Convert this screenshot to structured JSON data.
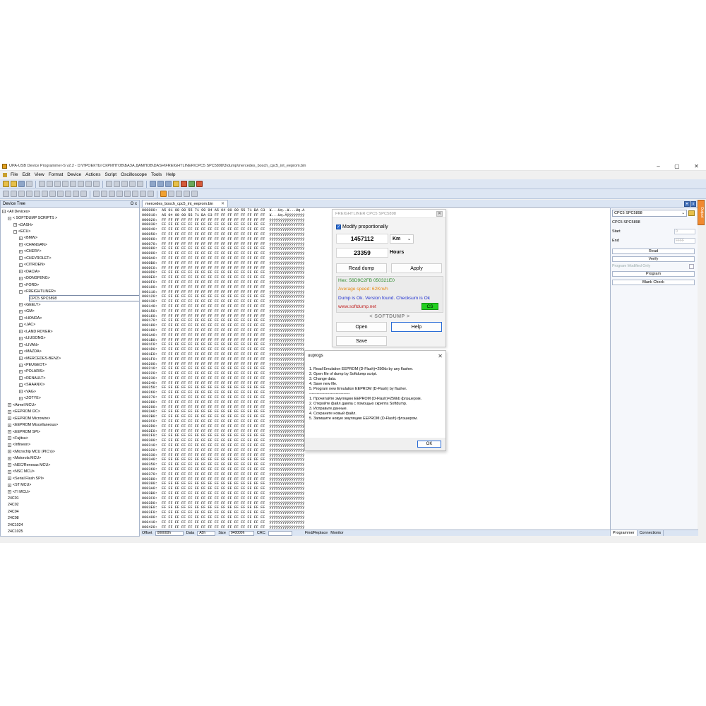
{
  "window": {
    "title": "UPA-USB Device Programmer-S v2.2 - D:\\ПРОЕКТЫ СКРИПТОВ\\БАЗА ДАМПОВ\\DASH\\FREIGHTLINER\\CPC5 SPC5898\\3\\dump\\mercedes_bosch_cpc5_int_eeprom.bin",
    "minimize": "–",
    "maximize": "▢",
    "close": "✕"
  },
  "menu": [
    "File",
    "Edit",
    "View",
    "Format",
    "Device",
    "Actions",
    "Script",
    "Oscilloscope",
    "Tools",
    "Help"
  ],
  "tree": {
    "header": "Device Tree",
    "pin": "ʘ x",
    "items": [
      {
        "label": "<All Devices>",
        "level": 0,
        "exp": "⊟"
      },
      {
        "label": "< SOFTDUMP SCRIPTS >",
        "level": 1,
        "exp": "⊟"
      },
      {
        "label": "<DASH>",
        "level": 2,
        "exp": "⊞"
      },
      {
        "label": "<ECU>",
        "level": 2,
        "exp": "⊟"
      },
      {
        "label": "<BMW>",
        "level": 3,
        "exp": "⊞"
      },
      {
        "label": "<CHANGAN>",
        "level": 3,
        "exp": "⊞"
      },
      {
        "label": "<CHERY>",
        "level": 3,
        "exp": "⊞"
      },
      {
        "label": "<CHEVROLET>",
        "level": 3,
        "exp": "⊞"
      },
      {
        "label": "<CITROEN>",
        "level": 3,
        "exp": "⊞"
      },
      {
        "label": "<DACIA>",
        "level": 3,
        "exp": "⊞"
      },
      {
        "label": "<DONGFENG>",
        "level": 3,
        "exp": "⊞"
      },
      {
        "label": "<FORD>",
        "level": 3,
        "exp": "⊞"
      },
      {
        "label": "<FREIGHTLINER>",
        "level": 3,
        "exp": "⊟"
      },
      {
        "label": "CPC5 SPC5898",
        "level": 5,
        "exp": "",
        "selected": true
      },
      {
        "label": "<GEELY>",
        "level": 3,
        "exp": "⊞"
      },
      {
        "label": "<GM>",
        "level": 3,
        "exp": "⊞"
      },
      {
        "label": "<HONDA>",
        "level": 3,
        "exp": "⊞"
      },
      {
        "label": "<JAC>",
        "level": 3,
        "exp": "⊞"
      },
      {
        "label": "<LAND ROVER>",
        "level": 3,
        "exp": "⊞"
      },
      {
        "label": "<LIUGONG>",
        "level": 3,
        "exp": "⊞"
      },
      {
        "label": "<LIVAN>",
        "level": 3,
        "exp": "⊞"
      },
      {
        "label": "<MAZDA>",
        "level": 3,
        "exp": "⊞"
      },
      {
        "label": "<MERCEDES-BENZ>",
        "level": 3,
        "exp": "⊞"
      },
      {
        "label": "<PEUGEOT>",
        "level": 3,
        "exp": "⊞"
      },
      {
        "label": "<POLARIS>",
        "level": 3,
        "exp": "⊞"
      },
      {
        "label": "<RENAULT>",
        "level": 3,
        "exp": "⊞"
      },
      {
        "label": "<SHAANXI>",
        "level": 3,
        "exp": "⊞"
      },
      {
        "label": "<VAG>",
        "level": 3,
        "exp": "⊞"
      },
      {
        "label": "<ZOTYE>",
        "level": 3,
        "exp": "⊞"
      },
      {
        "label": "<Atmel MCU>",
        "level": 1,
        "exp": "⊞"
      },
      {
        "label": "<EEPROM I2C>",
        "level": 1,
        "exp": "⊞"
      },
      {
        "label": "<EEPROM Microwire>",
        "level": 1,
        "exp": "⊞"
      },
      {
        "label": "<EEPROM Miscellaneous>",
        "level": 1,
        "exp": "⊞"
      },
      {
        "label": "<EEPROM SPI>",
        "level": 1,
        "exp": "⊞"
      },
      {
        "label": "<Fujitsu>",
        "level": 1,
        "exp": "⊞"
      },
      {
        "label": "<Infineon>",
        "level": 1,
        "exp": "⊞"
      },
      {
        "label": "<Microchip MCU (PIC's)>",
        "level": 1,
        "exp": "⊞"
      },
      {
        "label": "<Motorola MCU>",
        "level": 1,
        "exp": "⊞"
      },
      {
        "label": "<NEC/Renesas MCU>",
        "level": 1,
        "exp": "⊞"
      },
      {
        "label": "<NSC MCU>",
        "level": 1,
        "exp": "⊞"
      },
      {
        "label": "<Serial Flash SPI>",
        "level": 1,
        "exp": "⊞"
      },
      {
        "label": "<ST MCU>",
        "level": 1,
        "exp": "⊞"
      },
      {
        "label": "<TI MCU>",
        "level": 1,
        "exp": "⊞"
      },
      {
        "label": "24C01",
        "level": 1,
        "exp": ""
      },
      {
        "label": "24C02",
        "level": 1,
        "exp": ""
      },
      {
        "label": "24C04",
        "level": 1,
        "exp": ""
      },
      {
        "label": "24C08",
        "level": 1,
        "exp": ""
      },
      {
        "label": "24C1024",
        "level": 1,
        "exp": ""
      },
      {
        "label": "24C1025",
        "level": 1,
        "exp": ""
      },
      {
        "label": "24C128",
        "level": 1,
        "exp": ""
      }
    ]
  },
  "tab": {
    "label": "mercedes_bosch_cpc5_int_eeprom.bin",
    "close": "✕"
  },
  "hex": {
    "first_row": "000000:  A5 01 00 00 55 71 99 94 A5 04 00 00 55 71 BA C3  ¥...Uq..¥...Uq.Ã",
    "second_row": "000010:  A5 04 00 00 55 71 BA C3 FF FF FF FF FF FF FF FF  ¥...Uq.Ãÿÿÿÿÿÿÿÿ",
    "ff_bytes": "FF FF FF FF FF FF FF FF FF FF FF FF FF FF FF FF",
    "ff_ascii": "ÿÿÿÿÿÿÿÿÿÿÿÿÿÿÿÿ",
    "row_count": 68
  },
  "status": {
    "offset_label": "Offset",
    "offset_value": "000000h",
    "data_label": "Data",
    "data_value": "A5h",
    "size_label": "Size",
    "size_value": "040000h",
    "crc_label": "CRC",
    "crc_value": "",
    "find": "Find/Replace",
    "monitor": "Monitor"
  },
  "programmer": {
    "device_select": "CPC5 SPC5898",
    "device_name": "CPC5 SPC5898",
    "start_label": "Start",
    "start_value": "0",
    "end_label": "End",
    "end_value": "FFFF",
    "read": "Read",
    "verify": "Verify",
    "modified_only": "Program Modified Only",
    "program": "Program",
    "blank_check": "Blank Check",
    "tabs": [
      "Programmer",
      "Connections"
    ],
    "side_tab": "Output"
  },
  "freightliner": {
    "title": "FREIGHTLINER CPC5 SPC5898",
    "close": "✕",
    "modify_label": "Modify proportionally",
    "km_value": "1457112",
    "km_unit": "Km",
    "hours_value": "23359",
    "hours_label": "Hours",
    "read_dump": "Read dump",
    "apply": "Apply",
    "hex_line": "Hex: 56D9C2FB 050321E0",
    "avg_speed": "Average speed: 62Km/h",
    "status_line": "Dump is Ok. Version found. Checksum is Ok",
    "website": "www.softdump.net",
    "cs": "CS",
    "brand": "< SOFTDUMP >",
    "open": "Open",
    "help": "Help",
    "save": "Save",
    "colors": {
      "hex": "#2e8b2e",
      "speed": "#e88a10",
      "status": "#2030d0",
      "website": "#c02020",
      "cs": "#22d020"
    }
  },
  "message": {
    "title": "uuprogs",
    "close": "✕",
    "lines": [
      "1. Read Emulation EEPROM (D-Flash)=256kb by any flasher.",
      "2. Open file of dump by Softdump script.",
      "3. Change data.",
      "4. Save new file.",
      "5. Program new Emulation EEPROM (D-Flash) by flasher.",
      "--------------------------------",
      "1. Прочитайте эмуляцию EEPROM (D-Flash)=256kb флэшером.",
      "2. Откройте файл дампа с помощью скрипта Softdump.",
      "3. Исправьте данные.",
      "4. Сохраните новый файл.",
      "5. Запишите новую эмуляцию EEPROM (D-Flash) флэшером."
    ],
    "ok": "OK"
  }
}
